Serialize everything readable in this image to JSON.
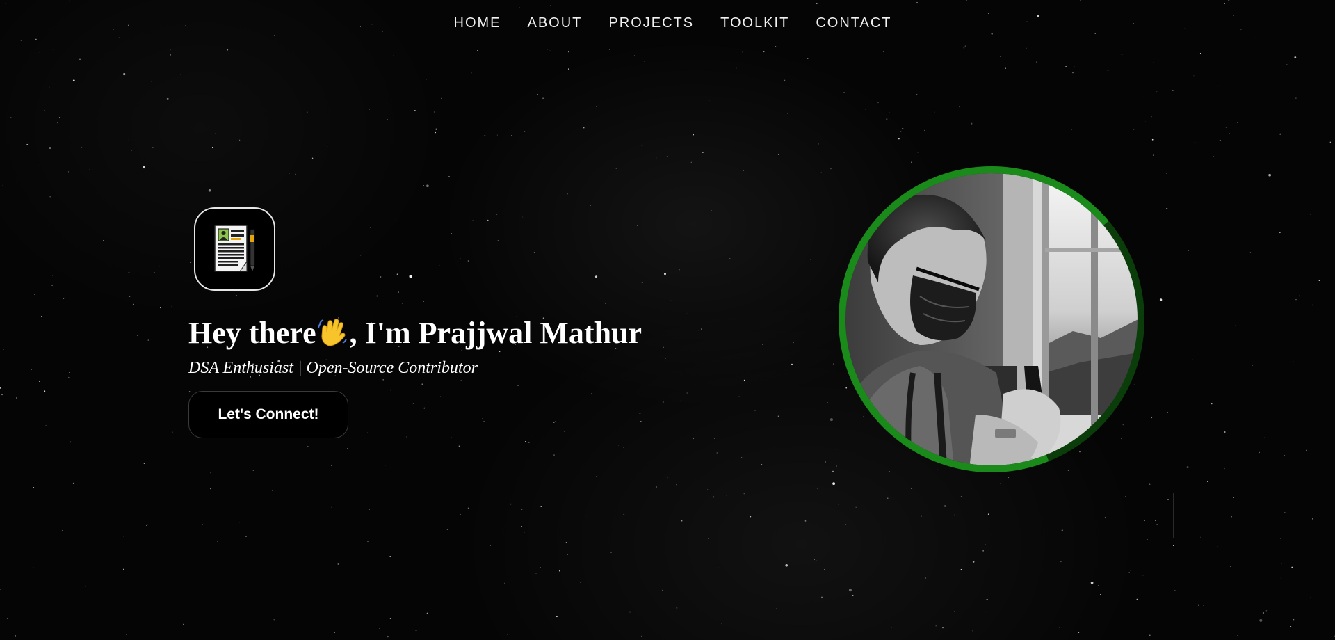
{
  "nav": {
    "items": [
      "HOME",
      "ABOUT",
      "PROJECTS",
      "TOOLKIT",
      "CONTACT"
    ]
  },
  "hero": {
    "greeting": "Hey there",
    "name_text": ", I'm Prajjwal Mathur",
    "subtitle": "DSA Enthusiast | Open-Source Contributor",
    "cta_label": "Let's Connect!",
    "logo_icon": "resume-document-icon",
    "wave_icon": "waving-hand-icon"
  },
  "portrait": {
    "icon": "profile-photo",
    "ring_color": "#1a8a1a",
    "ring_dark_color": "#0b3d0b",
    "ring_progress": 0.7
  },
  "colors": {
    "background": "#050505",
    "text": "#ffffff",
    "accent_green": "#1a8a1a"
  }
}
